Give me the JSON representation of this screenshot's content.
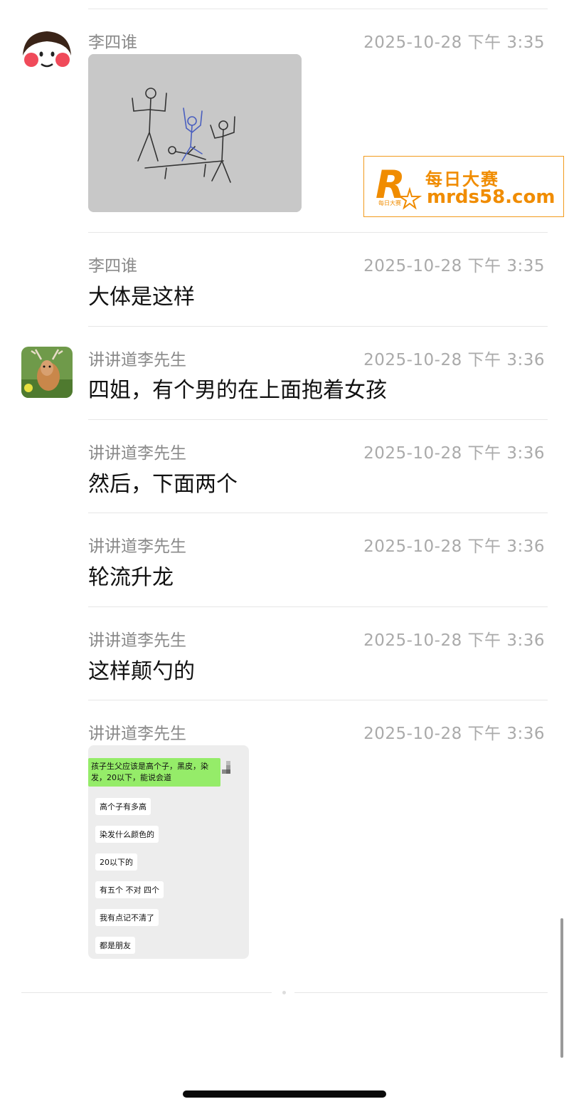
{
  "messages": [
    {
      "sender": "李四谁",
      "time": "2025-10-28 下午 3:35",
      "type": "image"
    },
    {
      "sender": "李四谁",
      "time": "2025-10-28 下午 3:35",
      "text": "大体是这样"
    },
    {
      "sender": "讲讲道李先生",
      "time": "2025-10-28 下午 3:36",
      "text": "四姐，有个男的在上面抱着女孩"
    },
    {
      "sender": "讲讲道李先生",
      "time": "2025-10-28 下午 3:36",
      "text": "然后，下面两个"
    },
    {
      "sender": "讲讲道李先生",
      "time": "2025-10-28 下午 3:36",
      "text": "轮流升龙"
    },
    {
      "sender": "讲讲道李先生",
      "time": "2025-10-28 下午 3:36",
      "text": "这样颠勺的"
    },
    {
      "sender": "讲讲道李先生",
      "time": "2025-10-28 下午 3:36",
      "type": "image"
    }
  ],
  "screenshot": {
    "green_text": "孩子生父应该是高个子，黑皮，染发，20以下，能说会道",
    "bubbles": [
      "高个子有多高",
      "染发什么颜色的",
      "20以下的",
      "有五个 不对 四个",
      "我有点记不清了",
      "都是朋友"
    ]
  },
  "watermark": {
    "cn": "每日大赛",
    "url": "mrds58.com",
    "small": "每日大赛",
    "letter": "R"
  },
  "colors": {
    "accent": "#f08c00",
    "chat_green": "#95ec69",
    "time_gray": "#aaaaaa"
  }
}
